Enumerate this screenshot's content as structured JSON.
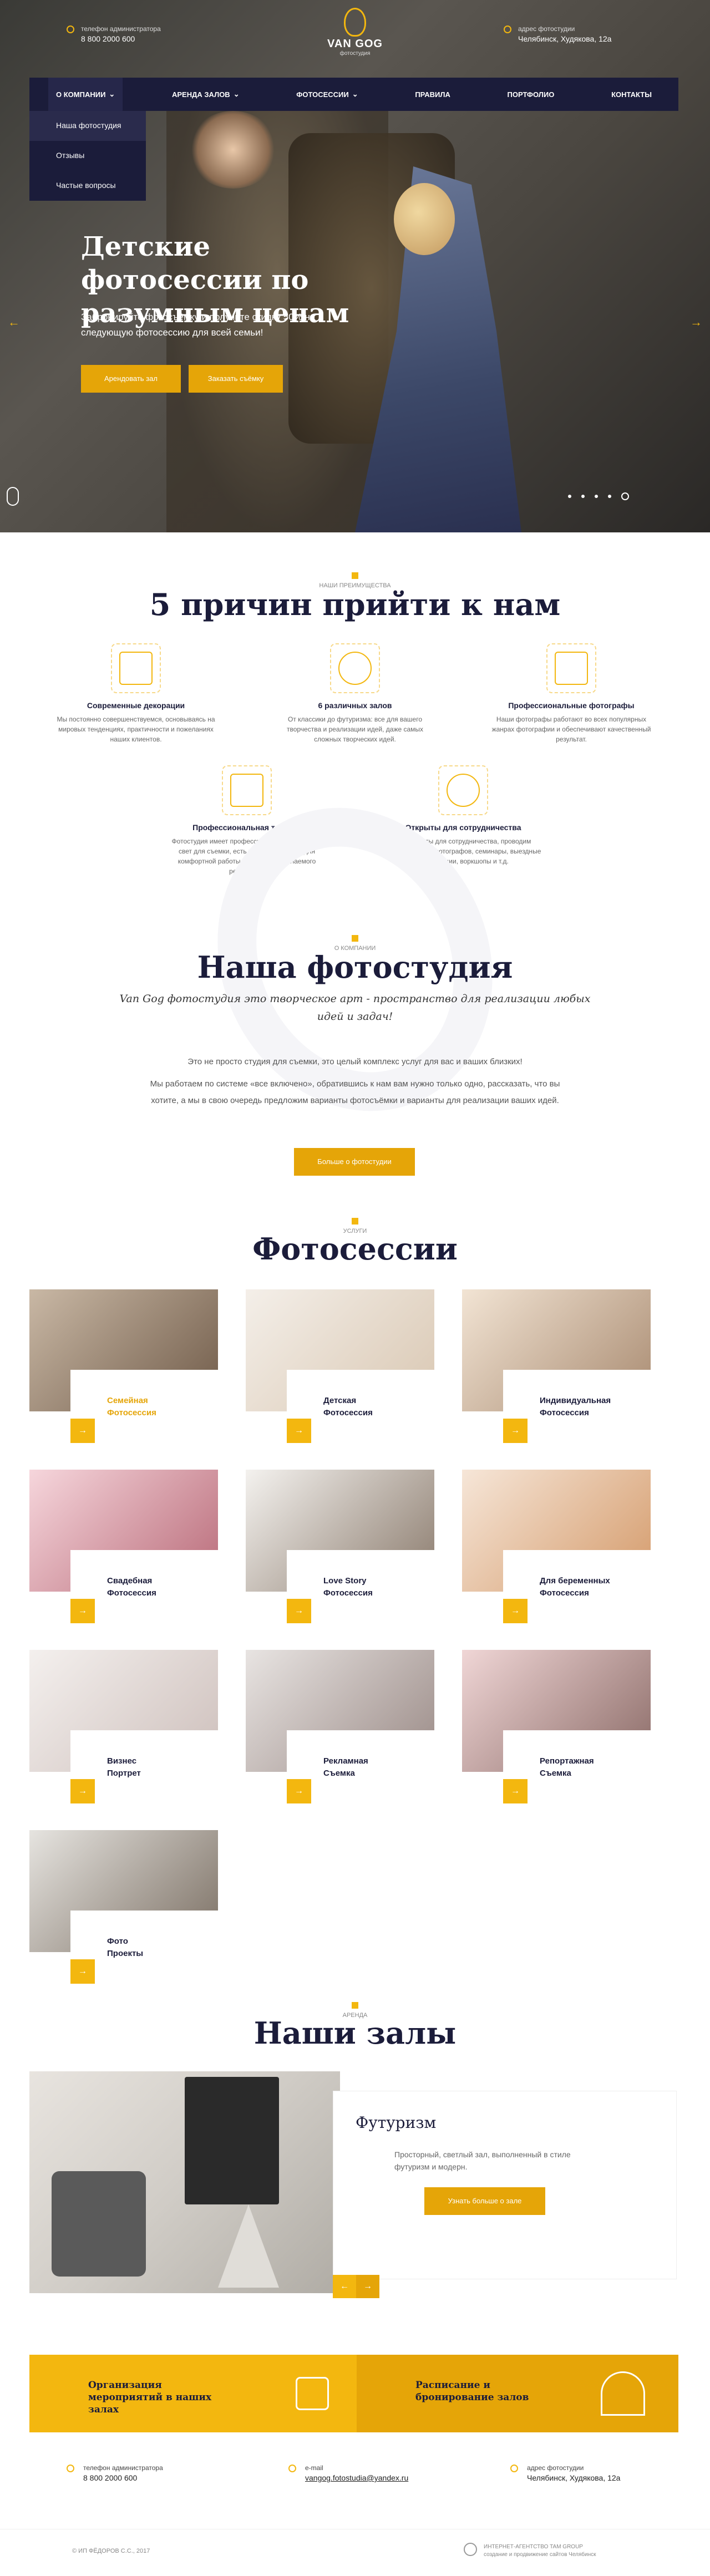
{
  "header": {
    "phone_label": "телефон администратора",
    "phone": "8 800 2000 600",
    "address_label": "адрес фотостудии",
    "address": "Челябинск, Худякова, 12а",
    "logo_name": "VAN GOG",
    "logo_sub": "фотостудия"
  },
  "nav": [
    {
      "label": "О компании",
      "has_caret": true
    },
    {
      "label": "Аренда залов",
      "has_caret": true
    },
    {
      "label": "Фотосессии",
      "has_caret": true
    },
    {
      "label": "Правила",
      "has_caret": false
    },
    {
      "label": "Портфолио",
      "has_caret": false
    },
    {
      "label": "Контакты",
      "has_caret": false
    }
  ],
  "dropdown": [
    "Наша фотостудия",
    "Отзывы",
    "Частые вопросы"
  ],
  "hero": {
    "title": "Детские фотосессии по разумным ценам",
    "text": "Забронируйте фотосъёмку и получите скидку 50% на следующую фотосессию для всей семьи!",
    "btn_primary": "Арендовать зал",
    "btn_secondary": "Заказать съёмку",
    "slides": 5,
    "active_slide": 5
  },
  "advantages": {
    "kicker": "наши преимущества",
    "title": "5 причин прийти к нам",
    "items": [
      {
        "name": "Современные декорации",
        "text": "Мы постоянно совершенствуемся, основываясь на мировых тенденциях, практичности и пожеланиях наших клиентов.",
        "icon": "decor-icon"
      },
      {
        "name": "6 различных залов",
        "text": "От классики до футуризма: все для вашего творчества и реализации идей, даже самых сложных творческих идей.",
        "icon": "halls-icon"
      },
      {
        "name": "Профессиональные фотографы",
        "text": "Наши фотографы работают во всех популярных жанрах фотографии и обеспечивают качественный результат.",
        "icon": "camera-icon"
      },
      {
        "name": "Профессиональная техника",
        "text": "Фотостудия имеет профессиональную технику и свет для съемки, есть всё необходимое для комфортной работы и получения желаемого результата.",
        "icon": "light-icon"
      },
      {
        "name": "Открыты для сотрудничества",
        "text": "Мы открыты для сотрудничества, проводим мастер-классы фотографов, семинары, выездные регистрации, ворк­шопы и т.д.",
        "icon": "handshake-icon"
      }
    ]
  },
  "about": {
    "kicker": "о компании",
    "title": "Наша фотостудия",
    "lead": "Van Gog фотостудия это творческое арт - пространство для реализации любых идей и задач!",
    "p1": "Это не просто студия для съемки, это целый комплекс услуг для вас и ваших близких!",
    "p2": "Мы работаем по системе «все включено», обратившись к нам вам нужно только одно, рассказать, что вы хотите, а мы в свою очередь предложим варианты фотосъёмки и варианты для реализации ваших идей.",
    "btn": "Больше о фотостудии"
  },
  "services": {
    "kicker": "услуги",
    "title": "Фотосессии",
    "items": [
      {
        "l1": "Семейная",
        "l2": "Фотосессия",
        "c1": "#c9b8a5",
        "c2": "#6f5a48",
        "hl": true
      },
      {
        "l1": "Детская",
        "l2": "Фотосессия",
        "c1": "#f4efe9",
        "c2": "#d9c7b2",
        "hl": false
      },
      {
        "l1": "Индивидуальная",
        "l2": "Фотосессия",
        "c1": "#f2e4d4",
        "c2": "#a88a70",
        "hl": false
      },
      {
        "l1": "Свадебная",
        "l2": "Фотосессия",
        "c1": "#f6d6dc",
        "c2": "#b86a78",
        "hl": false
      },
      {
        "l1": "Love Story",
        "l2": "Фотосессия",
        "c1": "#f4f2ef",
        "c2": "#8a7a6c",
        "hl": false
      },
      {
        "l1": "Для беременных",
        "l2": "Фотосессия",
        "c1": "#f6e6d8",
        "c2": "#d49a6a",
        "hl": false
      },
      {
        "l1": "Визнес",
        "l2": "Портрет",
        "c1": "#f4f0ee",
        "c2": "#cdbfbb",
        "hl": false
      },
      {
        "l1": "Рекламная",
        "l2": "Съемка",
        "c1": "#e8e4e2",
        "c2": "#9a8a86",
        "hl": false
      },
      {
        "l1": "Репортажная",
        "l2": "Съемка",
        "c1": "#f0d6d6",
        "c2": "#8a6a66",
        "hl": false
      },
      {
        "l1": "Фото",
        "l2": "Проекты",
        "c1": "#e6e4e0",
        "c2": "#7a6e62",
        "hl": false
      }
    ]
  },
  "halls": {
    "kicker": "аренда",
    "title": "Наши залы",
    "name": "Футуризм",
    "text": "Просторный, светлый зал, выполненный в стиле футуризм и модерн.",
    "btn": "Узнать больше о зале",
    "prev": "←",
    "next": "→"
  },
  "banners": {
    "left": "Организация мероприятий в наших залах",
    "right": "Расписание и бронирование залов"
  },
  "footer": {
    "phone_label": "телефон администратора",
    "phone": "8 800 2000 600",
    "email_label": "e-mail",
    "email": "vangog.fotostudia@yandex.ru",
    "address_label": "адрес фотостудии",
    "address": "Челябинск, Худякова, 12а",
    "copyright": "© ИП ФЁДОРОВ С.С., 2017",
    "credits_1": "ИНТЕРНЕТ-АГЕНТСТВО TAM GROUP",
    "credits_2": "создание и продвижение сайтов Челябинск"
  },
  "colors": {
    "accent": "#f3b70f",
    "accent_dark": "#e5a508",
    "navy": "#1b1c3a"
  }
}
